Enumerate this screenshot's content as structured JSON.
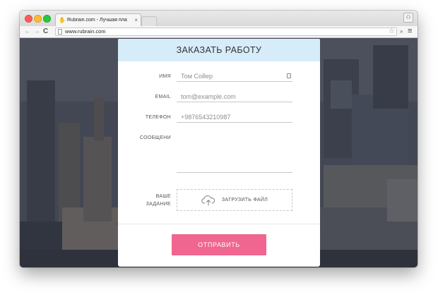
{
  "browser": {
    "tab_title": "Rubrain.com - Лучшая пла",
    "tab_close": "×",
    "url": "www.rubrain.com",
    "nav_back": "←",
    "nav_forward": "→",
    "nav_reload": "C",
    "star": "☆",
    "extensions": "»",
    "menu": "≡",
    "profile": "⚇"
  },
  "form": {
    "title": "ЗАКАЗАТЬ РАБОТУ",
    "fields": {
      "name": {
        "label": "ИМЯ",
        "placeholder": "Том Сойер"
      },
      "email": {
        "label": "EMAIL",
        "placeholder": "tom@example.com"
      },
      "phone": {
        "label": "ТЕЛЕФОН",
        "placeholder": "+9876543210987"
      },
      "message": {
        "label": "СООБЩЕНИ",
        "placeholder": ""
      }
    },
    "attachment": {
      "label_line1": "ВАШЕ",
      "label_line2": "ЗАДАНИЕ",
      "button": "ЗАГРУЗИТЬ ФАЙЛ"
    },
    "submit": "ОТПРАВИТЬ"
  },
  "colors": {
    "header_bg": "#d6ecf9",
    "submit_bg": "#f06690"
  }
}
